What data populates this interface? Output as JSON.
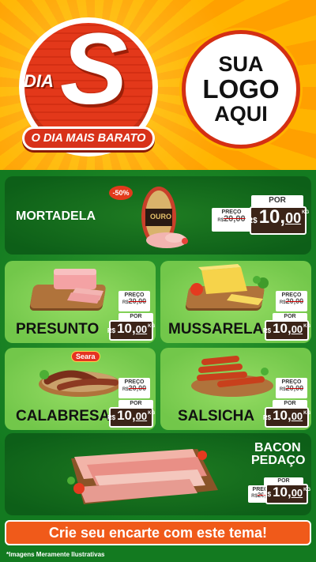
{
  "header": {
    "badge_dia": "DIA",
    "badge_letter": "S",
    "tagline": "O DIA MAIS BARATO",
    "logo_lines": [
      "SUA",
      "LOGO",
      "AQUI"
    ]
  },
  "products": [
    {
      "name": "MORTADELA",
      "discount": "-50%",
      "brand_label": "OURO",
      "preco_label": "PREÇO",
      "old_currency": "R$",
      "old_price": "20,00",
      "por_label": "POR",
      "currency": "R$",
      "price_int": "10,",
      "price_dec": "00",
      "unit": "KG"
    },
    {
      "name": "PRESUNTO",
      "preco_label": "PREÇO",
      "old_currency": "R$",
      "old_price": "20,00",
      "por_label": "POR",
      "currency": "R$",
      "price_int": "10,",
      "price_dec": "00",
      "unit": "KG"
    },
    {
      "name": "MUSSARELA",
      "preco_label": "PREÇO",
      "old_currency": "R$",
      "old_price": "20,00",
      "por_label": "POR",
      "currency": "R$",
      "price_int": "10,",
      "price_dec": "00",
      "unit": "KG"
    },
    {
      "name": "CALABRESA",
      "brand_label": "Seara",
      "preco_label": "PREÇO",
      "old_currency": "R$",
      "old_price": "20,00",
      "por_label": "POR",
      "currency": "R$",
      "price_int": "10,",
      "price_dec": "00",
      "unit": "KG"
    },
    {
      "name": "SALSICHA",
      "preco_label": "PREÇO",
      "old_currency": "R$",
      "old_price": "20,00",
      "por_label": "POR",
      "currency": "R$",
      "price_int": "10,",
      "price_dec": "00",
      "unit": "KG"
    },
    {
      "name_line1": "BACON",
      "name_line2": "PEDAÇO",
      "preco_label": "PREÇO",
      "old_currency": "R$",
      "old_price": "20,00",
      "por_label": "POR",
      "currency": "R$",
      "price_int": "10,",
      "price_dec": "00",
      "unit": "KG"
    }
  ],
  "cta": "Crie seu encarte com este tema!",
  "disclaimer": "*Imagens Meramente Ilustrativas",
  "colors": {
    "header_bg": "#ffa000",
    "brand_red": "#d42f13",
    "dark_green": "#0d5f18",
    "light_green": "#7ccb52",
    "price_bg": "#3b2418",
    "cta_orange": "#f05a1a"
  }
}
